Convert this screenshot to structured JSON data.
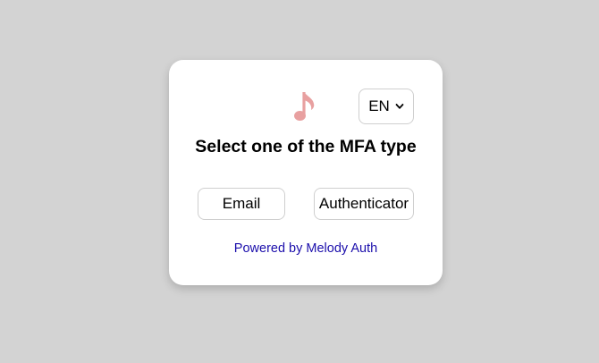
{
  "language": {
    "selected": "EN"
  },
  "heading": "Select one of the MFA type",
  "mfa_options": [
    {
      "label": "Email"
    },
    {
      "label": "Authenticator"
    }
  ],
  "footer": {
    "powered_by": "Powered by Melody Auth"
  },
  "colors": {
    "background": "#d3d3d3",
    "card": "#ffffff",
    "logo": "#e8a0a0",
    "link": "#1a0dab"
  },
  "icons": {
    "logo": "music-note-icon",
    "dropdown": "chevron-down-icon"
  }
}
